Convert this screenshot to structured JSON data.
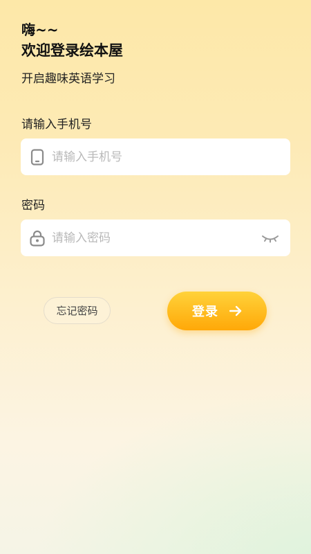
{
  "header": {
    "greeting": "嗨~~",
    "title": "欢迎登录绘本屋",
    "subtitle": "开启趣味英语学习"
  },
  "form": {
    "phone_label": "请输入手机号",
    "phone_placeholder": "请输入手机号",
    "phone_value": "",
    "phone_icon": "phone-icon",
    "password_label": "密码",
    "password_placeholder": "请输入密码",
    "password_value": "",
    "password_icon": "lock-icon",
    "visibility_icon": "eye-closed-icon"
  },
  "actions": {
    "forgot_label": "忘记密码",
    "login_label": "登录",
    "login_icon": "arrow-right-icon"
  },
  "colors": {
    "accent_start": "#ffd23a",
    "accent_end": "#ffa808",
    "background_top": "#fde8a8",
    "background_bottom": "#f5f4e6"
  }
}
